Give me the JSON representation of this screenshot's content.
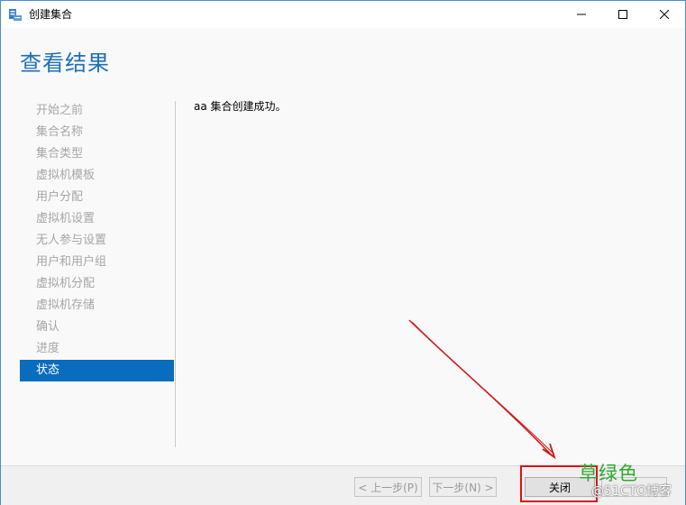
{
  "window": {
    "title": "创建集合",
    "icon": "server-manager-icon"
  },
  "page": {
    "title": "查看结果"
  },
  "nav": {
    "items": [
      {
        "label": "开始之前",
        "active": false
      },
      {
        "label": "集合名称",
        "active": false
      },
      {
        "label": "集合类型",
        "active": false
      },
      {
        "label": "虚拟机模板",
        "active": false
      },
      {
        "label": "用户分配",
        "active": false
      },
      {
        "label": "虚拟机设置",
        "active": false
      },
      {
        "label": "无人参与设置",
        "active": false
      },
      {
        "label": "用户和用户组",
        "active": false
      },
      {
        "label": "虚拟机分配",
        "active": false
      },
      {
        "label": "虚拟机存储",
        "active": false
      },
      {
        "label": "确认",
        "active": false
      },
      {
        "label": "进度",
        "active": false
      },
      {
        "label": "状态",
        "active": true
      }
    ]
  },
  "content": {
    "message": "aa 集合创建成功。"
  },
  "buttons": {
    "prev": "< 上一步(P)",
    "next": "下一步(N) >",
    "close": "关闭",
    "cancel": ""
  },
  "annotations": {
    "watermark": "草绿色",
    "site": "@51CTO博客",
    "highlight_color": "#e01010"
  },
  "colors": {
    "accent": "#1e6fb8",
    "active_nav": "#0a6cbd"
  }
}
